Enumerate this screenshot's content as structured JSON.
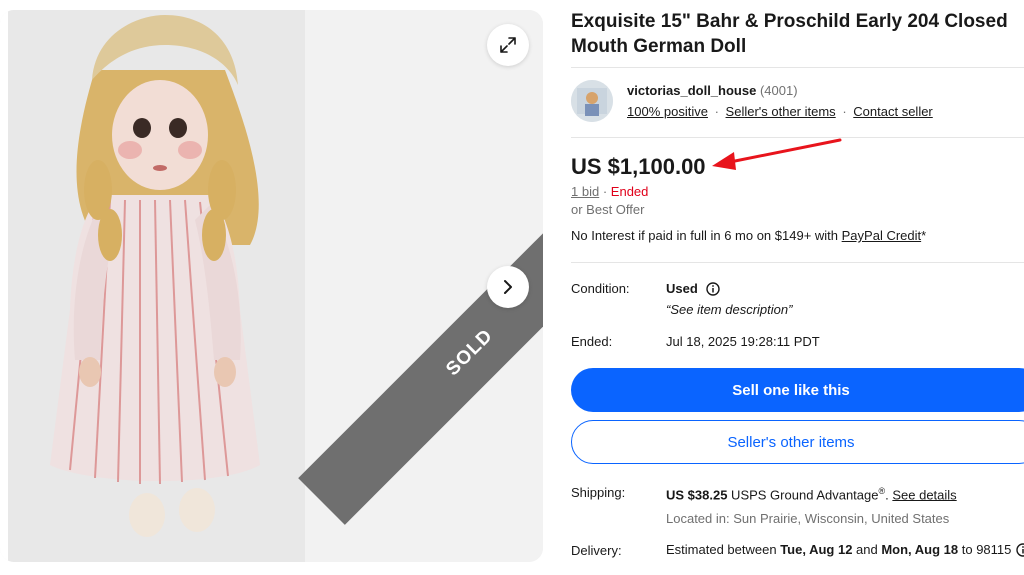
{
  "gallery": {
    "sold_label": "SOLD",
    "icons": {
      "expand": "expand-icon",
      "next": "chevron-right-icon"
    }
  },
  "listing": {
    "title": "Exquisite 15\" Bahr & Proschild Early 204 Closed Mouth German Doll"
  },
  "seller": {
    "name": "victorias_doll_house",
    "feedback_count": "(4001)",
    "positive": "100% positive",
    "other_items": "Seller's other items",
    "contact": "Contact seller"
  },
  "price": {
    "amount": "US $1,100.00",
    "bids": "1 bid",
    "separator": "·",
    "status": "Ended",
    "best_offer": "or Best Offer",
    "paypal_prefix": "No Interest if paid in full in 6 mo on $149+ with ",
    "paypal_link": "PayPal Credit",
    "paypal_suffix": "*"
  },
  "details": {
    "condition_label": "Condition:",
    "condition_value": "Used",
    "condition_desc": "“See item description”",
    "ended_label": "Ended:",
    "ended_value": "Jul 18, 2025 19:28:11 PDT"
  },
  "actions": {
    "sell_one": "Sell one like this",
    "seller_other": "Seller's other items"
  },
  "shipping": {
    "label": "Shipping:",
    "cost": "US $38.25",
    "service": " USPS Ground Advantage",
    "registered": "®",
    "period": ". ",
    "see_details": "See details",
    "location": "Located in: Sun Prairie, Wisconsin, United States"
  },
  "delivery": {
    "label": "Delivery:",
    "prefix": "Estimated between ",
    "date1": "Tue, Aug 12",
    "and": " and ",
    "date2": "Mon, Aug 18",
    "suffix": " to 98115"
  },
  "colors": {
    "accent_blue": "#0a64ff",
    "ended_red": "#e0001a",
    "sold_ribbon": "#6f6f6f",
    "annotation_arrow": "#e8141c"
  }
}
